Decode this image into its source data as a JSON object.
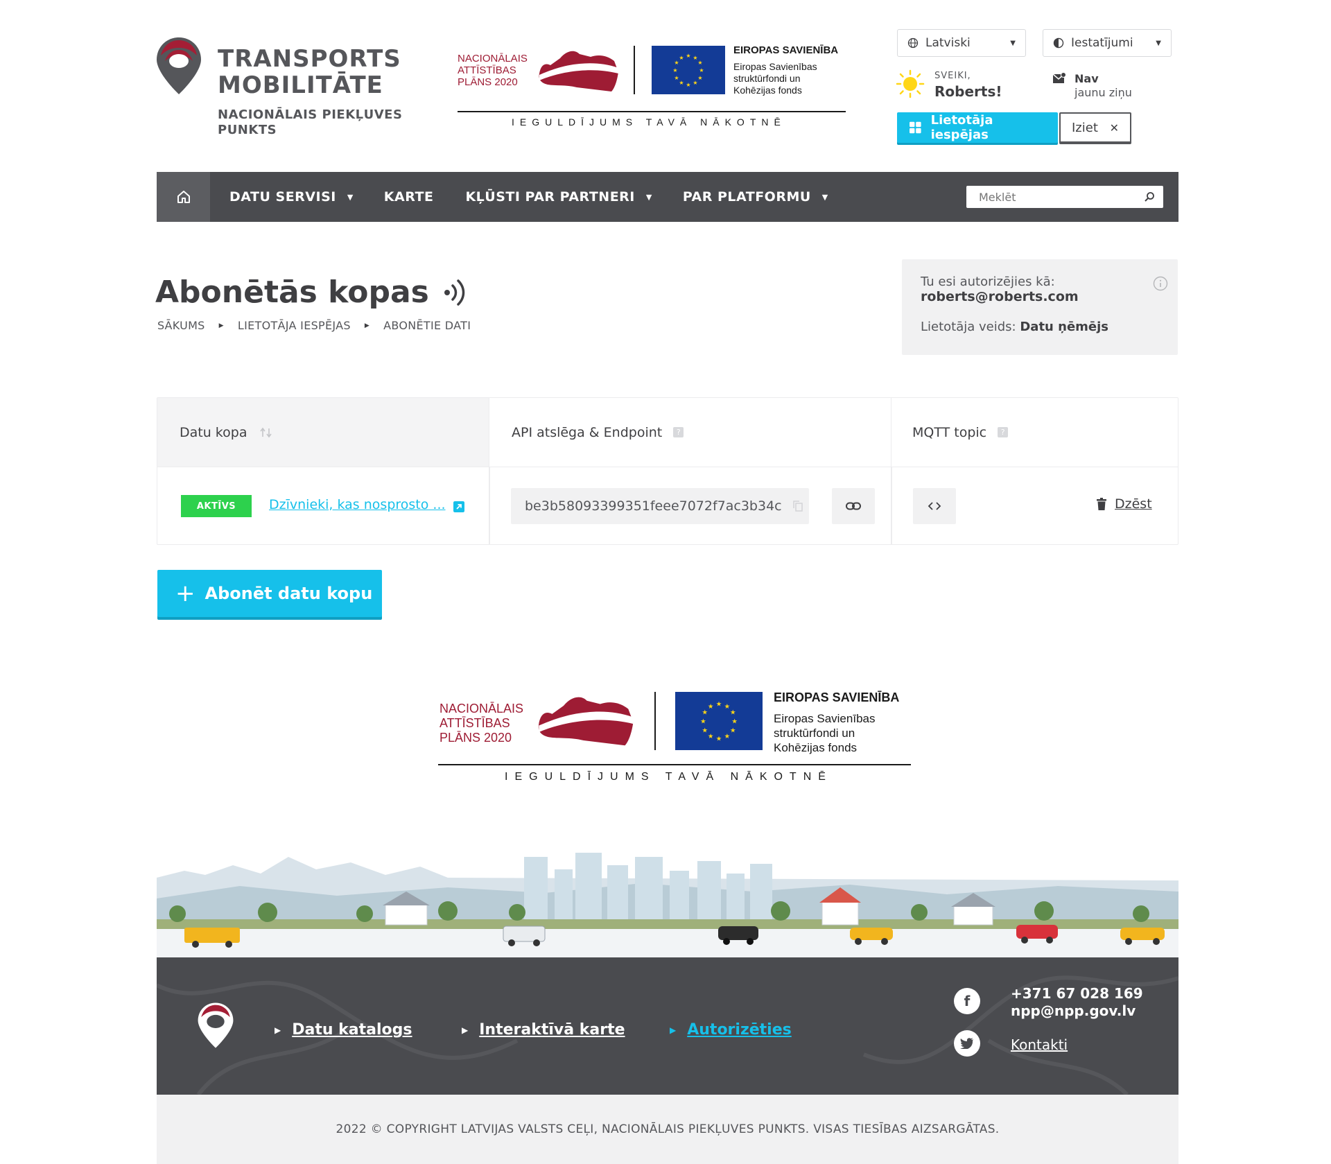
{
  "brand": {
    "title_line1": "TRANSPORTS",
    "title_line2": "MOBILITĀTE",
    "subtitle_line1": "NACIONĀLAIS PIEKĻUVES",
    "subtitle_line2": "PUNKTS"
  },
  "eu_logo": {
    "nap_line1": "NACIONĀLAIS",
    "nap_line2": "ATTĪSTĪBAS",
    "nap_line3": "PLĀNS 2020",
    "eu_title": "EIROPAS SAVIENĪBA",
    "eu_sub1": "Eiropas Savienības",
    "eu_sub2": "struktūrfondi un",
    "eu_sub3": "Kohēzijas fonds",
    "slogan": "IEGULDĪJUMS TAVĀ NĀKOTNĒ"
  },
  "header": {
    "language": "Latviski",
    "settings": "Iestatījumi",
    "greeting_small": "SVEIKI,",
    "greeting_name": "Roberts!",
    "news_line1": "Nav",
    "news_line2": "jaunu ziņu",
    "user_options": "Lietotāja iespējas",
    "logout": "Iziet"
  },
  "nav": {
    "items": [
      "DATU SERVISI",
      "KARTE",
      "KĻŪSTI PAR PARTNERI",
      "PAR PLATFORMU"
    ],
    "search_placeholder": "Meklēt"
  },
  "page": {
    "title": "Abonētās kopas",
    "breadcrumb": [
      "SĀKUMS",
      "LIETOTĀJA IESPĒJAS",
      "ABONĒTIE DATI"
    ]
  },
  "auth": {
    "label": "Tu esi autorizējies kā:",
    "email": "roberts@roberts.com",
    "type_label": "Lietotāja veids:",
    "type_value": "Datu ņēmējs"
  },
  "table": {
    "headers": [
      "Datu kopa",
      "API atslēga & Endpoint",
      "MQTT topic"
    ],
    "rows": [
      {
        "status": "AKTĪVS",
        "dataset": "Dzīvnieki, kas nosprosto ...",
        "api_key": "be3b58093399351feee7072f7ac3b34c",
        "delete": "Dzēst"
      }
    ]
  },
  "subscribe_button": "Abonēt datu kopu",
  "footer": {
    "links": [
      "Datu katalogs",
      "Interaktīvā karte",
      "Autorizēties"
    ],
    "phone": "+371 67 028 169",
    "email": "npp@npp.gov.lv",
    "contacts": "Kontakti",
    "copyright": "2022 © COPYRIGHT LATVIJAS VALSTS CEĻI, NACIONĀLAIS PIEKĻUVES PUNKTS. VISAS TIESĪBAS AIZSARGĀTAS."
  },
  "colors": {
    "accent": "#16c0ea",
    "brand_red": "#9e1c34",
    "nav_bg": "#4a4b4f",
    "active_green": "#2dd14d",
    "eu_blue": "#133b96"
  }
}
